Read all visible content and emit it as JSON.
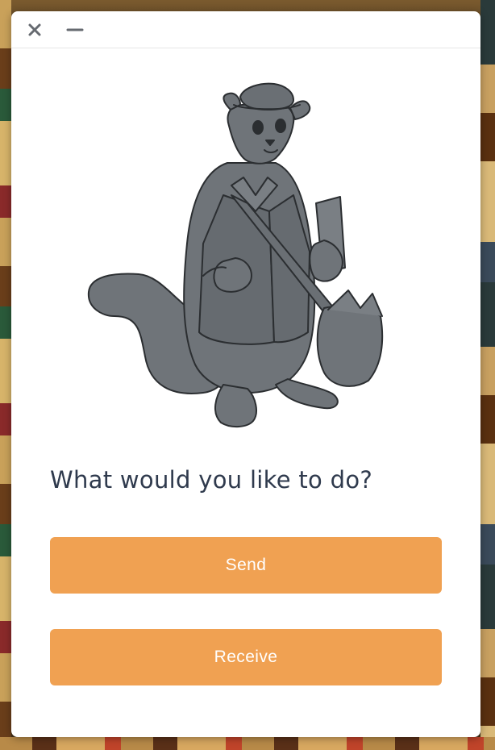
{
  "window": {
    "controls": {
      "close_icon": "close-icon",
      "minimize_icon": "minimize-icon"
    }
  },
  "illustration": {
    "icon": "ferret-mail-carrier-illustration"
  },
  "main": {
    "prompt": "What would you like to do?",
    "send_label": "Send",
    "receive_label": "Receive"
  },
  "colors": {
    "accent": "#f0a152",
    "prompt_text": "#2f3a4d",
    "illustration_fill": "#6f7479",
    "window_bg": "#ffffff"
  }
}
